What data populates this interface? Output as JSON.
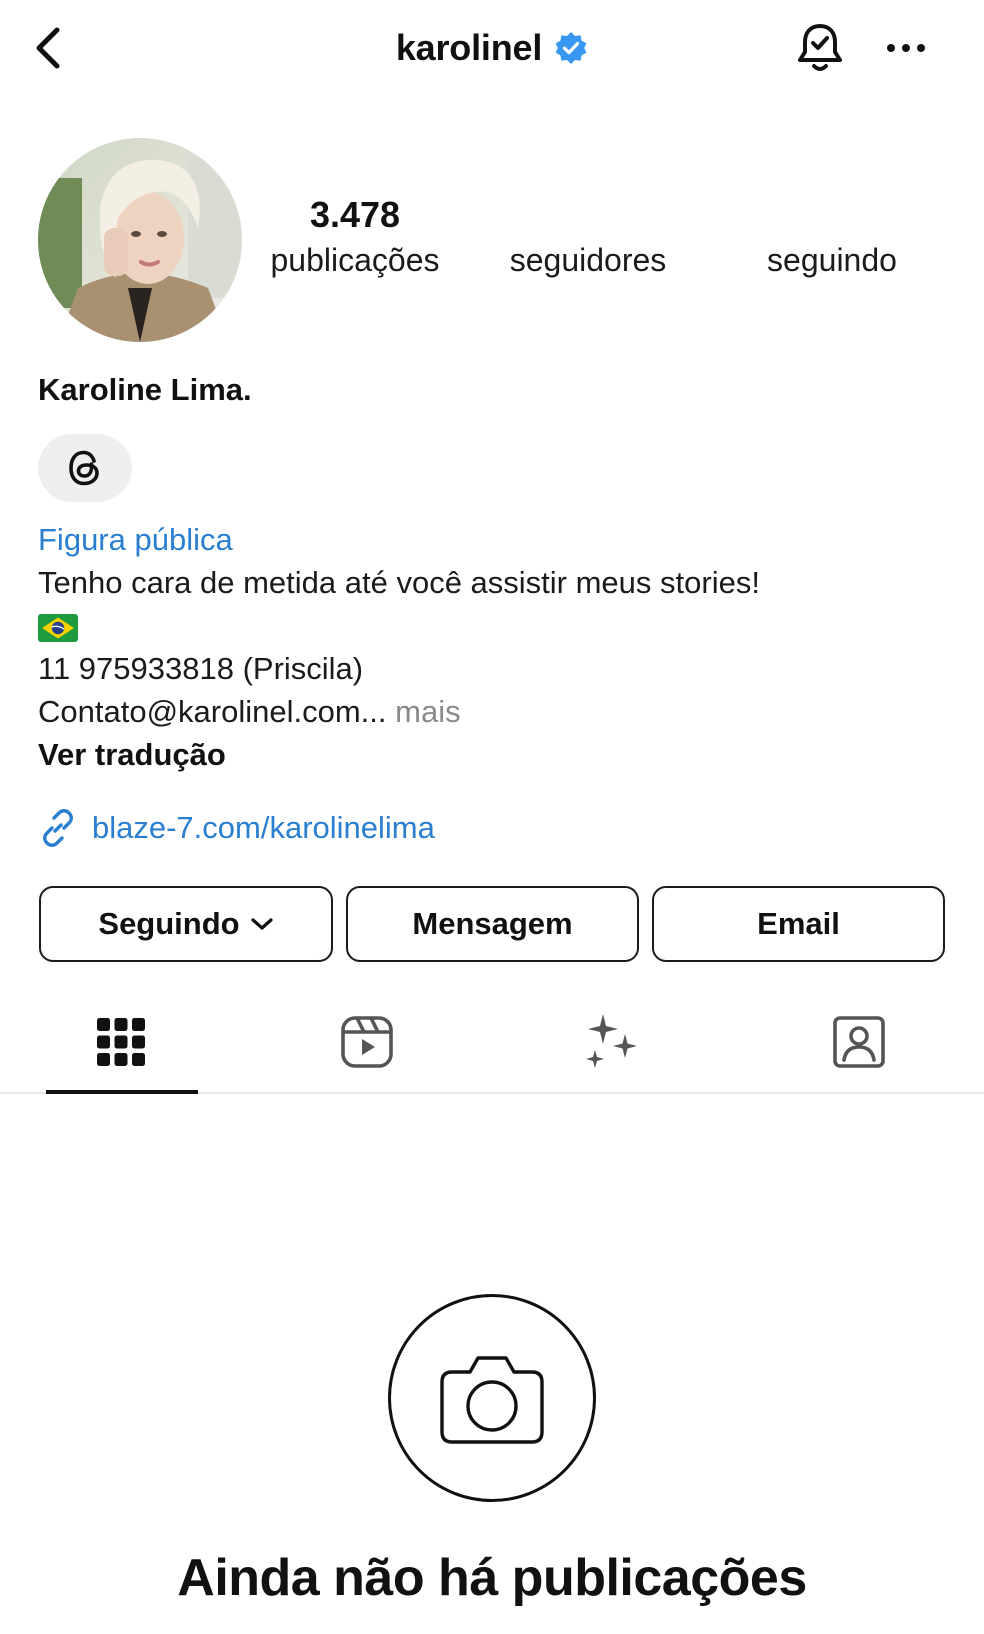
{
  "header": {
    "username": "karolinel",
    "icons": {
      "back": "chevron-left-icon",
      "verified": "verified-badge-icon",
      "notifications": "bell-check-icon",
      "more": "more-horizontal-icon"
    },
    "verified_color": "#3897f0"
  },
  "profile": {
    "avatar": "profile-photo",
    "stats": {
      "posts_count": "3.478",
      "posts_label": "publicações",
      "followers_label": "seguidores",
      "following_label": "seguindo"
    },
    "full_name": "Karoline Lima.",
    "threads_icon": "threads-icon"
  },
  "bio": {
    "category": "Figura pública",
    "line1": "Tenho cara de metida até você assistir meus stories!",
    "flag_icon": "brazil-flag-emoji",
    "line2": "11 975933818 (Priscila)",
    "line3": "Contato@karolinel.com...",
    "more_label": "mais",
    "translate_label": "Ver tradução"
  },
  "link": {
    "icon": "link-icon",
    "text": "blaze-7.com/karolinelima",
    "color": "#2a7fd0"
  },
  "actions": {
    "following_label": "Seguindo",
    "message_label": "Mensagem",
    "email_label": "Email"
  },
  "tabs": {
    "items": [
      "grid-icon",
      "reels-icon",
      "sparkles-icon",
      "tagged-icon"
    ],
    "active": "grid-icon"
  },
  "empty_state": {
    "icon": "camera-icon",
    "title": "Ainda não há publicações"
  }
}
